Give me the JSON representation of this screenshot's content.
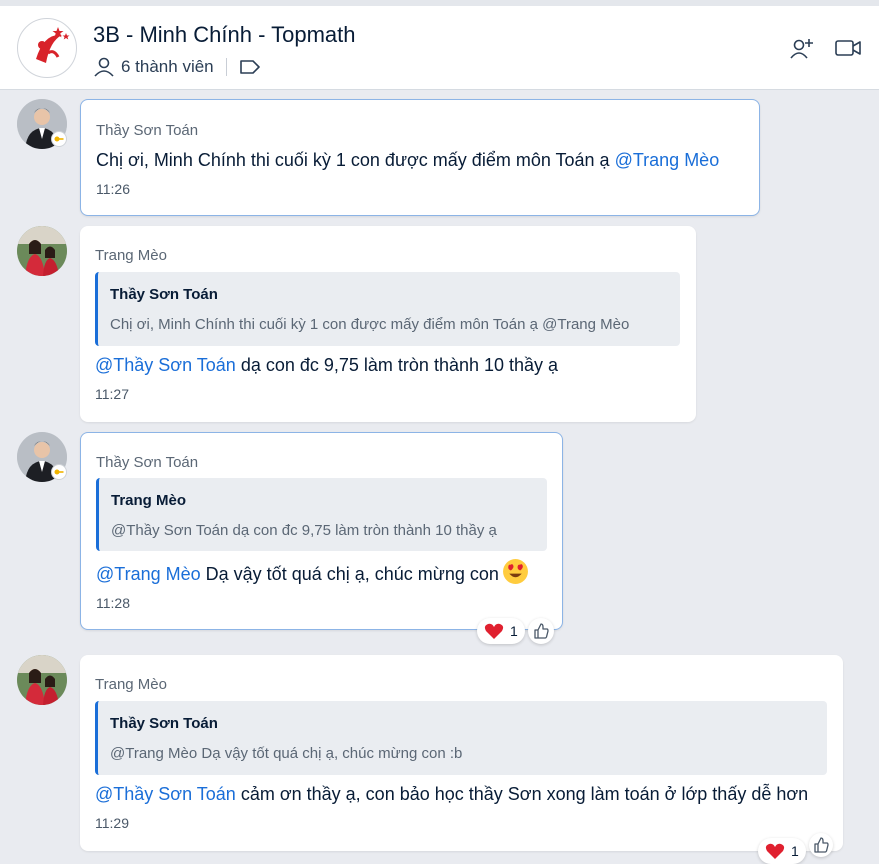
{
  "header": {
    "title": "3B - Minh Chính - Topmath",
    "members_label": "6 thành viên"
  },
  "messages": [
    {
      "sender": "Thầy Sơn Toán",
      "text": "Chị ơi, Minh Chính thi cuối kỳ 1 con được mấy điểm môn Toán ạ ",
      "mention": "@Trang Mèo",
      "time": "11:26"
    },
    {
      "sender": "Trang Mèo",
      "quote_name": "Thầy Sơn Toán",
      "quote_text": "Chị ơi, Minh Chính thi cuối kỳ 1 con được mấy điểm môn Toán ạ @Trang Mèo",
      "mention": "@Thầy Sơn Toán",
      "text": " dạ con đc 9,75 làm tròn thành 10 thầy ạ",
      "time": "11:27"
    },
    {
      "sender": "Thầy Sơn Toán",
      "quote_name": "Trang Mèo",
      "quote_text": "@Thầy Sơn Toán dạ con đc 9,75 làm tròn thành 10 thầy ạ",
      "mention": "@Trang Mèo",
      "text": " Dạ vậy tốt quá chị ạ, chúc mừng con",
      "emoji": "heart-eyes-emoji",
      "time": "11:28",
      "reaction_count": "1"
    },
    {
      "sender": "Trang Mèo",
      "quote_name": "Thầy Sơn Toán",
      "quote_text": "@Trang Mèo Dạ vậy tốt quá chị ạ, chúc mừng con :b",
      "mention": "@Thầy Sơn Toán",
      "text": " cảm ơn thầy ạ, con bảo học thầy Sơn xong làm toán ở lớp thấy dễ hơn",
      "time": "11:29",
      "reaction_count": "1"
    }
  ],
  "colors": {
    "accent": "#1a6ed8",
    "background": "#e9ebf0",
    "heart": "#e0202f"
  }
}
